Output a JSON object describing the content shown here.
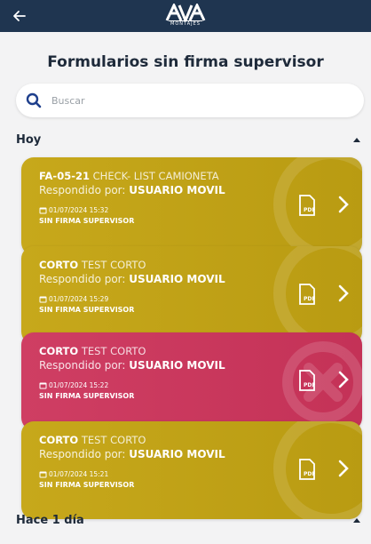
{
  "header": {
    "logo_letters": "AVA",
    "logo_sub": "MONTAJES"
  },
  "page": {
    "title": "Formularios sin firma supervisor"
  },
  "search": {
    "placeholder": "Buscar"
  },
  "sections": [
    {
      "title": "Hoy",
      "cards": [
        {
          "code": "FA-05-21",
          "name": "CHECK- LIST CAMIONETA",
          "responded_label": "Respondido por:",
          "user": "USUARIO MOVIL",
          "date": "01/07/2024 15:32",
          "status": "SIN FIRMA SUPERVISOR",
          "color": "#c3a418",
          "icon": "pdf-icon"
        },
        {
          "code": "CORTO",
          "name": "TEST CORTO",
          "responded_label": "Respondido por:",
          "user": "USUARIO MOVIL",
          "date": "01/07/2024 15:29",
          "status": "SIN FIRMA SUPERVISOR",
          "color": "#c3a418",
          "icon": "pdf-icon"
        },
        {
          "code": "CORTO",
          "name": "TEST CORTO",
          "responded_label": "Respondido por:",
          "user": "USUARIO MOVIL",
          "date": "01/07/2024 15:22",
          "status": "SIN FIRMA SUPERVISOR",
          "color": "#cb3a5e",
          "icon": "pdf-icon",
          "background_icon": "x-circle-icon"
        },
        {
          "code": "CORTO",
          "name": "TEST CORTO",
          "responded_label": "Respondido por:",
          "user": "USUARIO MOVIL",
          "date": "01/07/2024 15:21",
          "status": "SIN FIRMA SUPERVISOR",
          "color": "#c3a418",
          "icon": "pdf-icon"
        }
      ]
    },
    {
      "title": "Hace 1 día",
      "cards": []
    }
  ]
}
